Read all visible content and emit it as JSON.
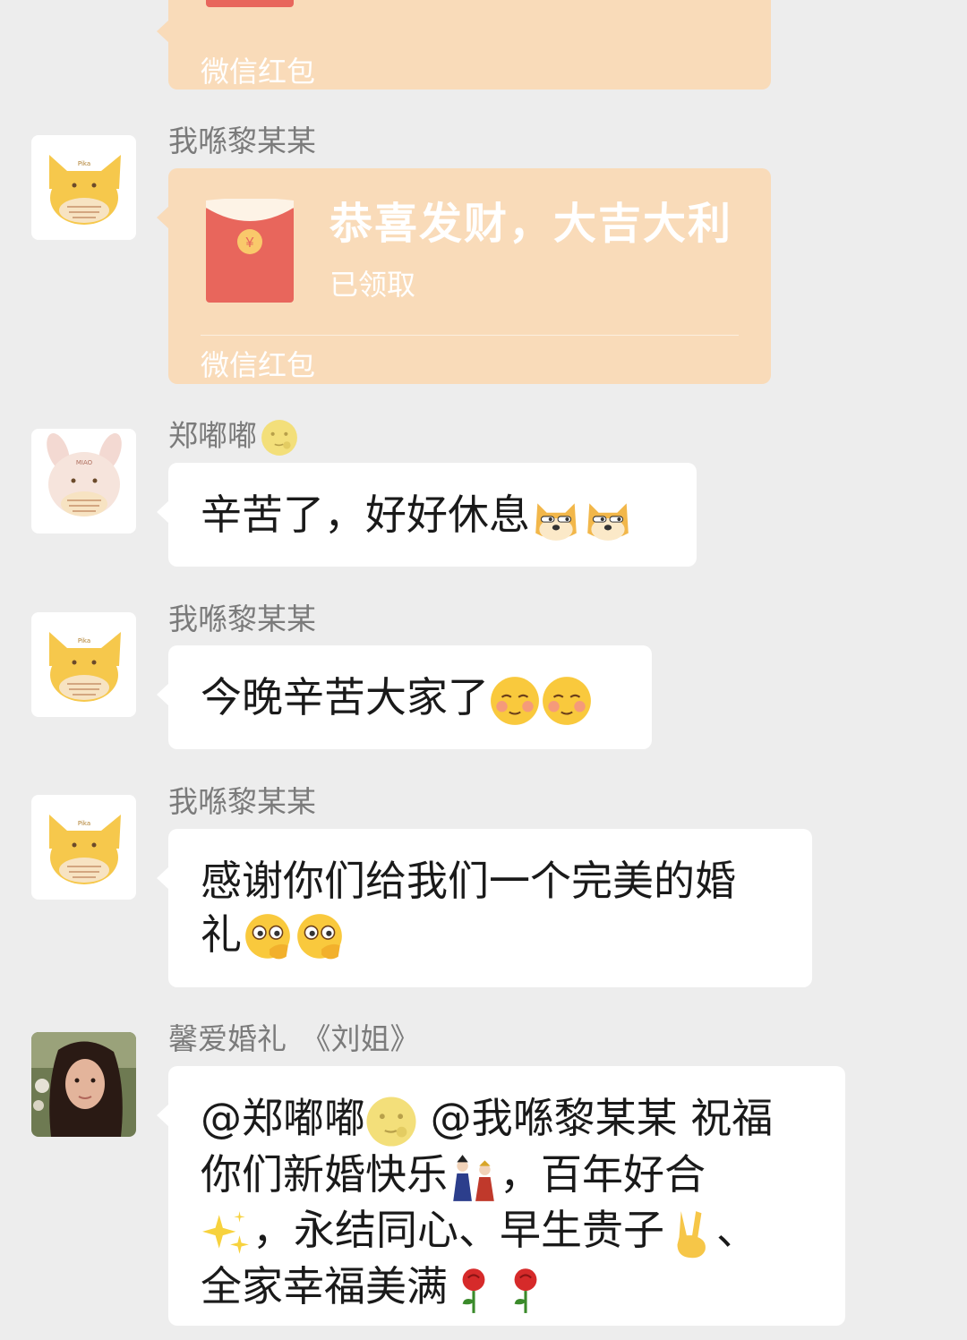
{
  "colors": {
    "background": "#ededed",
    "bubble": "#ffffff",
    "redpacket_bubble": "#f9dbb9",
    "envelope_red": "#e8665c",
    "sender_text": "#7b7b7b"
  },
  "messages": [
    {
      "type": "redpacket_partial",
      "footer": "微信红包"
    },
    {
      "type": "redpacket",
      "sender": "我喺黎某某",
      "avatar": "yellow-cat-hat-avatar",
      "title": "恭喜发财，大吉大利",
      "status": "已领取",
      "footer": "微信红包"
    },
    {
      "type": "text",
      "sender": "郑嘟嘟",
      "sender_emoji": "moon-face-icon",
      "avatar": "bunny-hat-avatar",
      "text": "辛苦了，好好休息",
      "emojis": [
        "doge-icon",
        "doge-icon"
      ]
    },
    {
      "type": "text",
      "sender": "我喺黎某某",
      "avatar": "yellow-cat-hat-avatar",
      "text": "今晚辛苦大家了",
      "emojis": [
        "blush-face-icon",
        "blush-face-icon"
      ]
    },
    {
      "type": "text",
      "sender": "我喺黎某某",
      "avatar": "yellow-cat-hat-avatar",
      "line1": "感谢你们给我们一个完美的婚",
      "line2": "礼",
      "emojis": [
        "thinking-face-icon",
        "thinking-face-icon"
      ]
    },
    {
      "type": "text",
      "sender": "馨爱婚礼　《刘姐》",
      "avatar": "woman-photo-avatar",
      "l1a": "@郑嘟嘟",
      "l1b": " @我喺黎某某 祝福",
      "l2a": "你们新婚快乐",
      "l2b": "，百年好合",
      "l3a": "，永结同心、早生贵子",
      "l3b": "、",
      "l4": "全家幸福美满",
      "emojis": [
        "moon-face-icon",
        "dolls-icon",
        "sparkles-icon",
        "victory-hand-icon",
        "rose-icon",
        "rose-icon"
      ]
    }
  ]
}
